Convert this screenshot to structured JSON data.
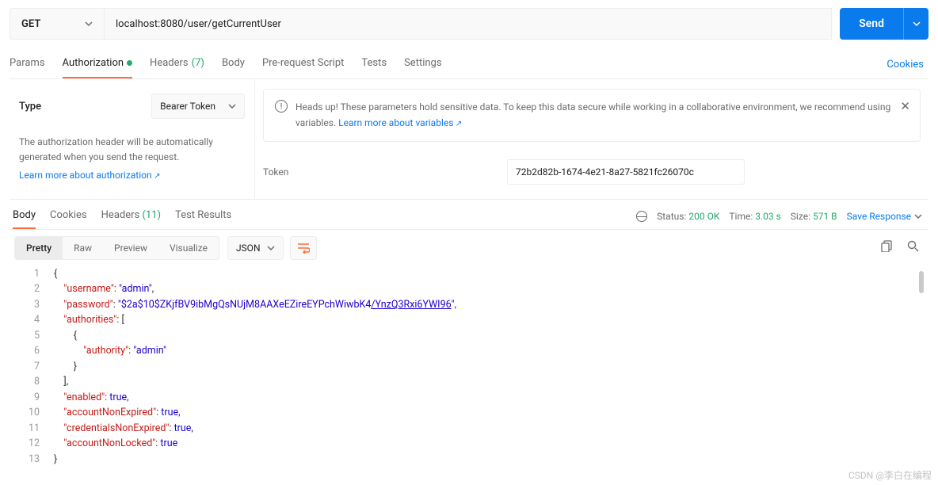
{
  "request": {
    "method": "GET",
    "url": "localhost:8080/user/getCurrentUser",
    "send_label": "Send"
  },
  "req_tabs": {
    "params": "Params",
    "authorization": "Authorization",
    "headers": "Headers",
    "headers_count": "(7)",
    "body": "Body",
    "prerequest": "Pre-request Script",
    "tests": "Tests",
    "settings": "Settings",
    "cookies": "Cookies"
  },
  "auth": {
    "type_label": "Type",
    "type_value": "Bearer Token",
    "desc": "The authorization header will be automatically generated when you send the request.",
    "learn_link": "Learn more about authorization",
    "banner": "Heads up! These parameters hold sensitive data. To keep this data secure while working in a collaborative environment, we recommend using variables.",
    "banner_link": "Learn more about variables",
    "token_label": "Token",
    "token_value": "72b2d82b-1674-4e21-8a27-5821fc26070c"
  },
  "resp_tabs": {
    "body": "Body",
    "cookies": "Cookies",
    "headers": "Headers",
    "headers_count": "(11)",
    "test_results": "Test Results"
  },
  "status": {
    "label": "Status:",
    "value": "200 OK",
    "time_label": "Time:",
    "time_value": "3.03 s",
    "size_label": "Size:",
    "size_value": "571 B",
    "save_response": "Save Response"
  },
  "view": {
    "pretty": "Pretty",
    "raw": "Raw",
    "preview": "Preview",
    "visualize": "Visualize",
    "format": "JSON"
  },
  "json_lines": [
    {
      "n": "1",
      "t": "{",
      "cls": "p"
    },
    {
      "n": "2",
      "content": [
        {
          "t": "    \"username\"",
          "c": "k"
        },
        {
          "t": ": ",
          "c": "p"
        },
        {
          "t": "\"admin\"",
          "c": "s"
        },
        {
          "t": ",",
          "c": "p"
        }
      ]
    },
    {
      "n": "3",
      "content": [
        {
          "t": "    \"password\"",
          "c": "k"
        },
        {
          "t": ": ",
          "c": "p"
        },
        {
          "t": "\"$2a$10$ZKjfBV9ibMgQsNUjM8AAXeEZireEYPchWiwbK4",
          "c": "s"
        },
        {
          "t": "/YnzQ3Rxi6YWI96",
          "c": "s u"
        },
        {
          "t": "\"",
          "c": "s"
        },
        {
          "t": ",",
          "c": "p"
        }
      ]
    },
    {
      "n": "4",
      "content": [
        {
          "t": "    \"authorities\"",
          "c": "k"
        },
        {
          "t": ": [",
          "c": "p"
        }
      ]
    },
    {
      "n": "5",
      "content": [
        {
          "t": "        {",
          "c": "p"
        }
      ]
    },
    {
      "n": "6",
      "content": [
        {
          "t": "            \"authority\"",
          "c": "k"
        },
        {
          "t": ": ",
          "c": "p"
        },
        {
          "t": "\"admin\"",
          "c": "s"
        }
      ]
    },
    {
      "n": "7",
      "content": [
        {
          "t": "        }",
          "c": "p"
        }
      ]
    },
    {
      "n": "8",
      "content": [
        {
          "t": "    ],",
          "c": "p"
        }
      ]
    },
    {
      "n": "9",
      "content": [
        {
          "t": "    \"enabled\"",
          "c": "k"
        },
        {
          "t": ": ",
          "c": "p"
        },
        {
          "t": "true",
          "c": "b"
        },
        {
          "t": ",",
          "c": "p"
        }
      ]
    },
    {
      "n": "10",
      "content": [
        {
          "t": "    \"accountNonExpired\"",
          "c": "k"
        },
        {
          "t": ": ",
          "c": "p"
        },
        {
          "t": "true",
          "c": "b"
        },
        {
          "t": ",",
          "c": "p"
        }
      ]
    },
    {
      "n": "11",
      "content": [
        {
          "t": "    \"credentialsNonExpired\"",
          "c": "k"
        },
        {
          "t": ": ",
          "c": "p"
        },
        {
          "t": "true",
          "c": "b"
        },
        {
          "t": ",",
          "c": "p"
        }
      ]
    },
    {
      "n": "12",
      "content": [
        {
          "t": "    \"accountNonLocked\"",
          "c": "k"
        },
        {
          "t": ": ",
          "c": "p"
        },
        {
          "t": "true",
          "c": "b"
        }
      ]
    },
    {
      "n": "13",
      "t": "}",
      "cls": "p"
    }
  ],
  "watermark": "CSDN @李白在编程"
}
